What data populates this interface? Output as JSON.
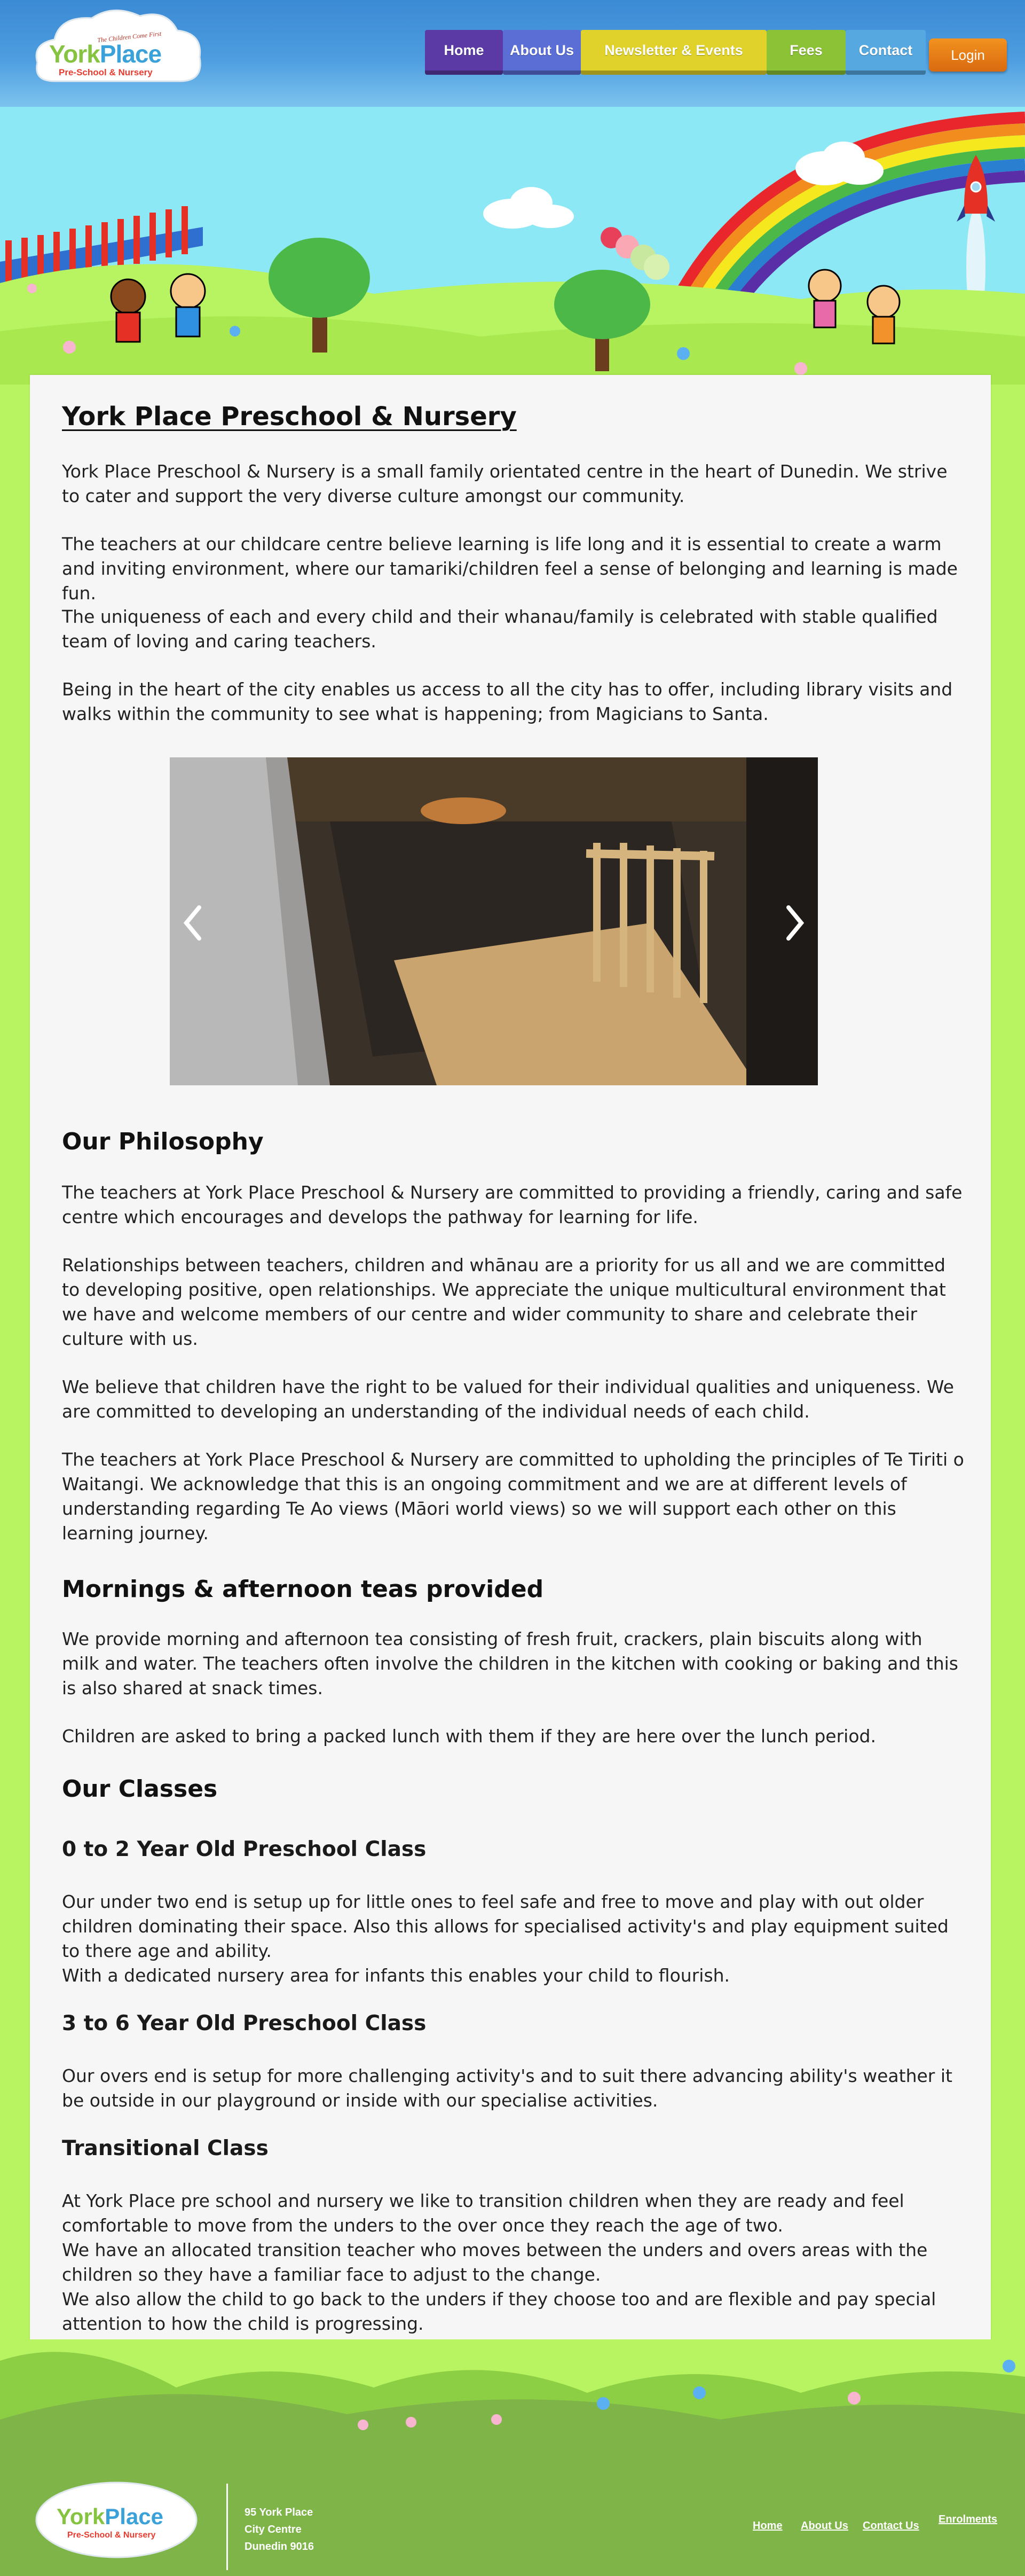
{
  "header": {
    "logo_name_a": "York",
    "logo_name_b": "Place",
    "logo_subtitle": "Pre-School & Nursery",
    "logo_tagline": "The Children Come First"
  },
  "nav": {
    "home": "Home",
    "about": "About Us",
    "newsletter": "Newsletter & Events",
    "fees": "Fees",
    "contact": "Contact",
    "login": "Login"
  },
  "main": {
    "title": "York Place Preschool & Nursery",
    "intro": [
      "York Place Preschool & Nursery is a small family orientated centre in the heart of Dunedin. We strive to cater and support the very diverse culture amongst our community.",
      "The teachers at our childcare centre believe learning is life long and it is essential to create a warm and inviting environment, where our tamariki/children feel a sense of belonging and learning is made fun.",
      "The uniqueness of each and every child and their whanau/family is celebrated with stable qualified team of loving and caring teachers.",
      "Being in the heart of the city enables us access to all the city has to offer, including library visits and walks within the community to see what is happening; from Magicians to Santa."
    ],
    "philosophy": {
      "heading": "Our Philosophy",
      "paragraphs": [
        "The teachers at York Place Preschool & Nursery are committed to providing a friendly, caring and safe centre which encourages and develops the pathway for learning for life.",
        "Relationships between teachers, children and whānau are a priority for us all and we are committed to developing positive, open relationships. We appreciate the unique multicultural environment that we have and welcome members of our centre and wider community to share and celebrate their culture with us.",
        "We believe that children have the right to be valued for their individual qualities and uniqueness. We are committed to developing an understanding of the individual needs of each child.",
        "The teachers at York Place Preschool & Nursery are committed to upholding the principles of Te Tiriti o Waitangi. We acknowledge that this is an ongoing commitment and we are at different levels of understanding regarding Te Ao views (Māori world views) so we will support each other on this learning journey."
      ]
    },
    "teas": {
      "heading": "Mornings & afternoon teas provided",
      "paragraphs": [
        "We provide morning and afternoon tea consisting of fresh fruit, crackers, plain biscuits along with milk and water. The teachers often involve the children in the kitchen with cooking or baking and this is also shared at snack times.",
        "Children are asked to bring a packed lunch with them if they are here over the lunch period."
      ]
    },
    "classes": {
      "heading": "Our Classes",
      "under_two": {
        "heading": "0 to 2 Year Old Preschool Class",
        "line1": "Our under two end is setup up for little ones to feel safe and free to move and play with out older children dominating their space. Also this allows for specialised activity's and play equipment suited to there age and ability.",
        "line2": "With a dedicated nursery area for infants this enables your child to flourish."
      },
      "overs": {
        "heading": "3 to 6 Year Old Preschool Class",
        "line1": "Our overs end is setup for more challenging activity's and to suit there advancing ability's weather it be outside in our playground or inside with our specialise activities."
      },
      "transitional": {
        "heading": "Transitional Class",
        "line1": "At York Place pre school and nursery we like to transition children when they are ready and feel comfortable to move from the unders to the over once they reach the age of two.",
        "line2": "We have an allocated transition teacher who moves between the unders and overs areas with the children so they have a familiar face to adjust to the change.",
        "line3": "We also allow the child to go back to the unders if they choose too and are flexible and pay special attention to how the child is progressing."
      }
    }
  },
  "footer": {
    "address": [
      "95 York Place",
      "City Centre",
      "Dunedin 9016"
    ],
    "links": {
      "home": "Home",
      "about": "About Us",
      "contact": "Contact Us",
      "enrolments": "Enrolments"
    }
  }
}
